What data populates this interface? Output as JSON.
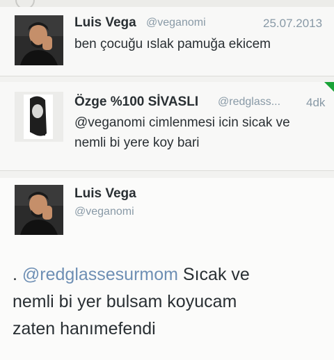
{
  "tweets": [
    {
      "name": "Luis Vega",
      "handle": "@veganomi",
      "date": "25.07.2013",
      "text": "ben çocuğu ıslak pamuğa ekicem"
    },
    {
      "name": "Özge %100 SİVASLI",
      "handle": "@redglass...",
      "date": "4dk",
      "text_line1": "@veganomi cimlenmesi icin sicak ve",
      "text_line2": "nemli bi yere koy bari"
    },
    {
      "name": "Luis Vega",
      "handle": "@veganomi",
      "prefix": ". ",
      "mention": "@redglassesurmom",
      "line1_rest": " Sıcak ve",
      "line2": "nemli bi yer bulsam koyucam",
      "line3": "zaten hanımefendi"
    }
  ],
  "colors": {
    "mention": "#6e8fb4",
    "name": "#292f33",
    "meta": "#8899a6",
    "corner_accent": "#19a337"
  }
}
